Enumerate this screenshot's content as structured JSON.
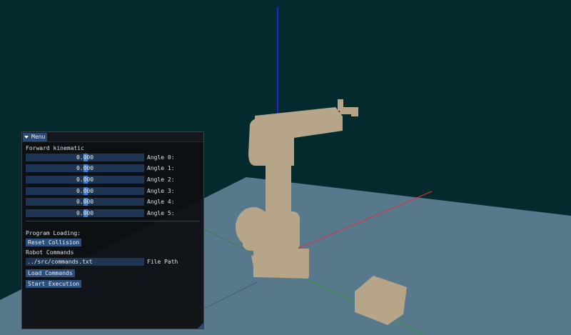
{
  "menu": {
    "title": "Menu",
    "collapse_icon": "triangle-down-icon"
  },
  "forward_kinematic": {
    "heading": "Forward kinematic",
    "angles": [
      {
        "value": "0.000",
        "label": "Angle 0:"
      },
      {
        "value": "0.000",
        "label": "Angle 1:"
      },
      {
        "value": "0.000",
        "label": "Angle 2:"
      },
      {
        "value": "0.000",
        "label": "Angle 3:"
      },
      {
        "value": "0.000",
        "label": "Angle 4:"
      },
      {
        "value": "0.000",
        "label": "Angle 5:"
      }
    ]
  },
  "program": {
    "heading": "Program Loading:",
    "reset_collision": "Reset Collision",
    "robot_commands": "Robot Commands",
    "file_path_value": "../src/commands.txt",
    "file_path_label": "File Path",
    "load_commands": "Load Commands",
    "start_execution": "Start Execution"
  },
  "colors": {
    "background": "#052a2e",
    "ground_plane": "#5f7e93",
    "robot": "#b7a58a",
    "axis_x": "#e0303a",
    "axis_y": "#2fa03a",
    "axis_z": "#2a1fd0",
    "accent": "#3d7fd9"
  }
}
